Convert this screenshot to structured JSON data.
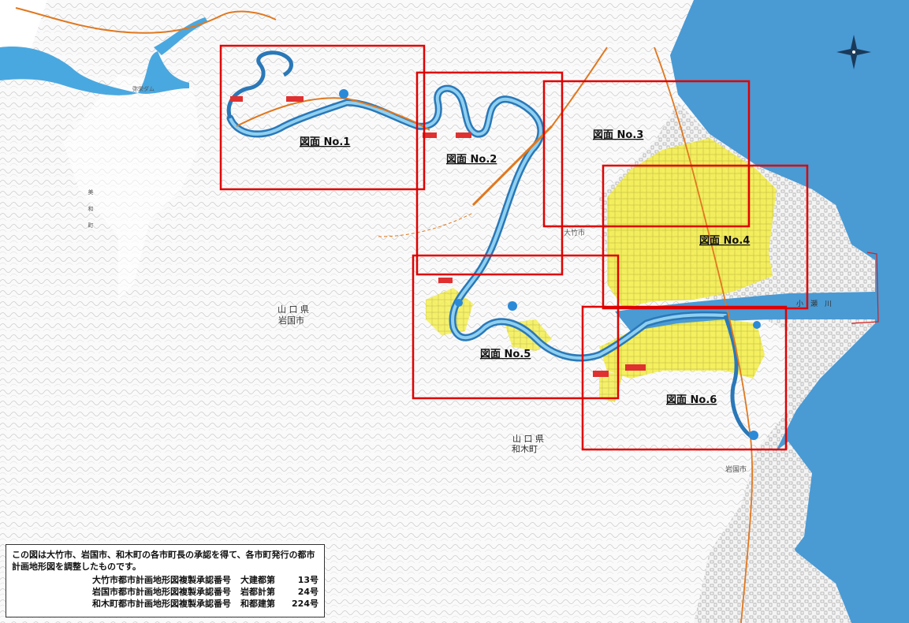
{
  "sheets": [
    {
      "label": "図面 No.1"
    },
    {
      "label": "図面 No.2"
    },
    {
      "label": "図面 No.3"
    },
    {
      "label": "図面 No.4"
    },
    {
      "label": "図面 No.5"
    },
    {
      "label": "図面 No.6"
    }
  ],
  "places": {
    "iwakuni_pref": "山 口 県",
    "iwakuni_city": "岩国市",
    "waki_pref": "山 口 県",
    "waki_town": "和木町",
    "otake": "大竹市",
    "iwakuni_south": "岩国市",
    "river": "小　瀬　川",
    "dam": "弥栄ダム",
    "misawa": "美　　和　　町"
  },
  "notice": {
    "intro": "この図は大竹市、岩国市、和木町の各市町長の承認を得て、各市町発行の都市計画地形図を調整したものです。",
    "rows": [
      {
        "name": "大竹市都市計画地形図複製承認番号",
        "office": "大建都第",
        "num": "13号"
      },
      {
        "name": "岩国市都市計画地形図複製承認番号",
        "office": "岩都計第",
        "num": "24号"
      },
      {
        "name": "和木町都市計画地形図複製承認番号",
        "office": "和都建第",
        "num": "224号"
      }
    ]
  },
  "colors": {
    "sea": "#4a9ad4",
    "river": "#4aa8e0",
    "flood_zone": "#f2ef5a",
    "frame": "#e00000",
    "road": "#e07820",
    "contour": "#bfbfbf"
  },
  "icons": {
    "north_arrow": "compass-rose-icon"
  }
}
